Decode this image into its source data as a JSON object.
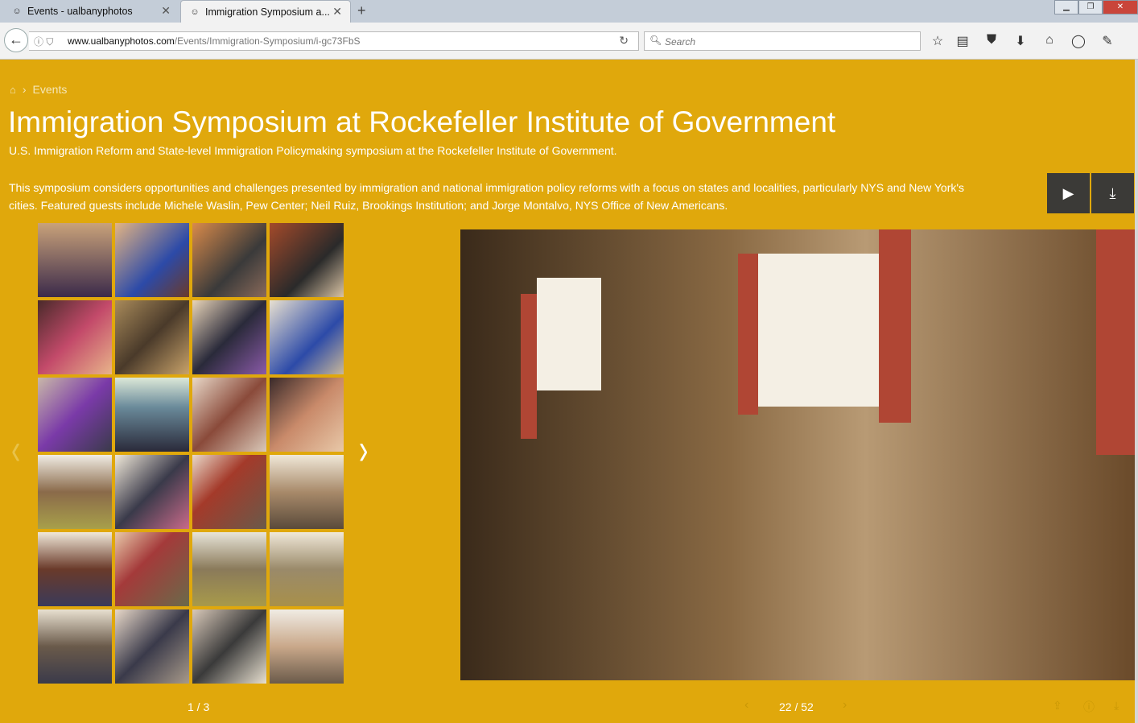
{
  "browser": {
    "tabs": [
      {
        "title": "Events - ualbanyphotos",
        "favicon": "smiley-icon"
      },
      {
        "title": "Immigration Symposium a...",
        "favicon": "smiley-icon"
      }
    ],
    "url_domain": "www.ualbanyphotos.com",
    "url_path": "/Events/Immigration-Symposium/i-gc73FbS",
    "search_placeholder": "Search"
  },
  "breadcrumb": {
    "item": "Events"
  },
  "gallery": {
    "title": "Immigration Symposium at Rockefeller Institute of Government",
    "subtitle": "U.S. Immigration Reform and State-level Immigration Policymaking symposium at the Rockefeller Institute of Government.",
    "description": "This symposium considers opportunities and challenges presented by immigration and national immigration policy reforms with a focus on states and localities, particularly NYS and New York's cities. Featured guests include Michele Waslin, Pew Center; Neil Ruiz, Brookings Institution; and Jorge Montalvo, NYS Office of New Americans.",
    "thumb_page": "1 / 3",
    "photo_counter": "22 / 52"
  },
  "colors": {
    "accent": "#e0a80c",
    "button_dark": "#3b3a37"
  }
}
